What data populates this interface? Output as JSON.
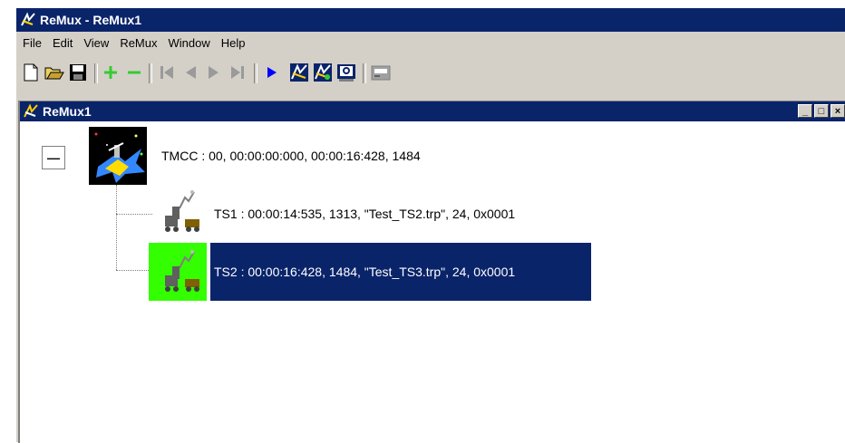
{
  "window": {
    "title": "ReMux - ReMux1"
  },
  "menu": {
    "items": [
      "File",
      "Edit",
      "View",
      "ReMux",
      "Window",
      "Help"
    ]
  },
  "toolbar": {
    "buttons": [
      "new-icon",
      "open-icon",
      "save-icon",
      "add-icon",
      "remove-icon",
      "first-icon",
      "prev-icon",
      "next-icon",
      "last-icon",
      "play-icon",
      "remux-icon",
      "remux-all-icon",
      "view-icon",
      "settings-icon"
    ]
  },
  "child": {
    "title": "ReMux1",
    "min_label": "_",
    "max_label": "□",
    "close_label": "×"
  },
  "tree": {
    "root": {
      "label": "TMCC : 00, 00:00:00:000, 00:00:16:428, 1484",
      "expander": "—"
    },
    "items": [
      {
        "label": "TS1 : 00:00:14:535, 1313, \"Test_TS2.trp\", 24, 0x0001"
      },
      {
        "label": "TS2 : 00:00:16:428, 1484, \"Test_TS3.trp\", 24, 0x0001",
        "selected": true
      }
    ]
  },
  "colors": {
    "title_bar": "#0a246a",
    "chrome": "#d4d0c8",
    "selected_bg": "#0a246a",
    "selected_icon_bg": "#33ff00"
  }
}
